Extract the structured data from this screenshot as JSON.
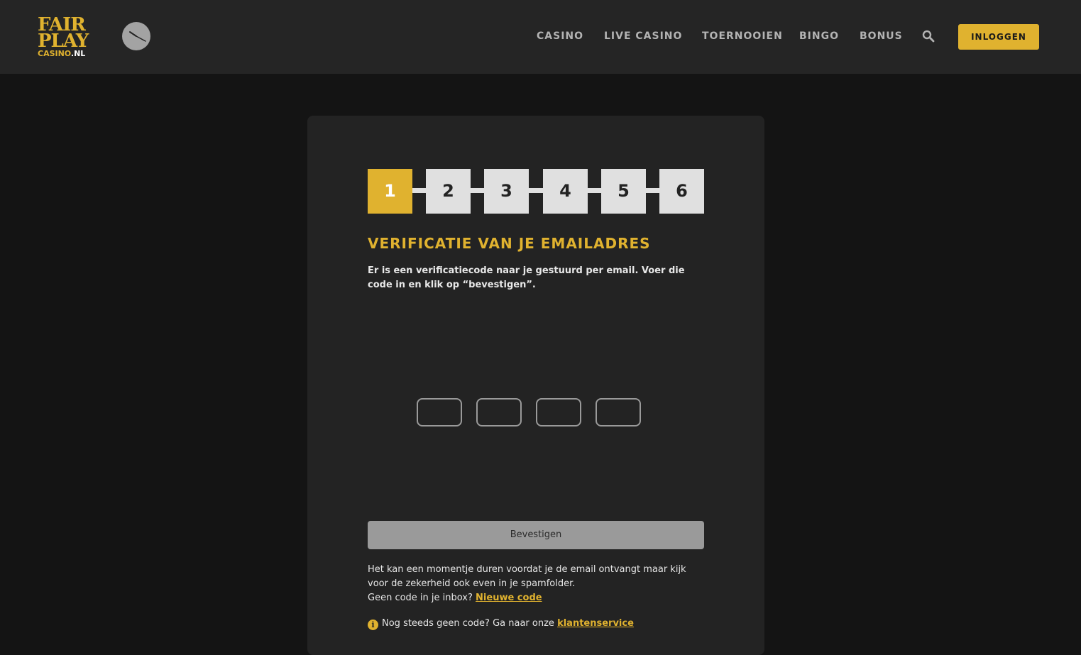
{
  "header": {
    "logo": {
      "line1": "FAIR",
      "line2": "PLAY",
      "line3_brand": "CASINO",
      "line3_tld": ".NL"
    },
    "nav": [
      {
        "label": "CASINO"
      },
      {
        "label": "LIVE CASINO"
      },
      {
        "label": "TOERNOOIEN"
      },
      {
        "label": "BINGO"
      },
      {
        "label": "BONUS"
      }
    ],
    "search_icon": "search-icon",
    "login_label": "INLOGGEN"
  },
  "steps": [
    "1",
    "2",
    "3",
    "4",
    "5",
    "6"
  ],
  "active_step": 1,
  "verification": {
    "title": "VERIFICATIE VAN JE EMAILADRES",
    "description": "Er is een verificatiecode naar je gestuurd per email. Voer die code in en klik op “bevestigen”.",
    "code_values": [
      "",
      "",
      "",
      ""
    ],
    "confirm_label": "Bevestigen",
    "info_line1": "Het kan een momentje duren voordat je de email ontvangt maar kijk voor de zekerheid ook even in je spamfolder.",
    "info_line2_prefix": "Geen code in je inbox?",
    "new_code_link": "Nieuwe code",
    "help_prefix": "Nog steeds geen code? Ga naar onze",
    "support_link": "klantenservice",
    "info_icon_glyph": "i"
  },
  "colors": {
    "accent": "#e0b22f",
    "header_bg": "#252525",
    "page_bg": "#141414",
    "card_bg": "#232323",
    "disabled_button": "#9a9a9a"
  }
}
